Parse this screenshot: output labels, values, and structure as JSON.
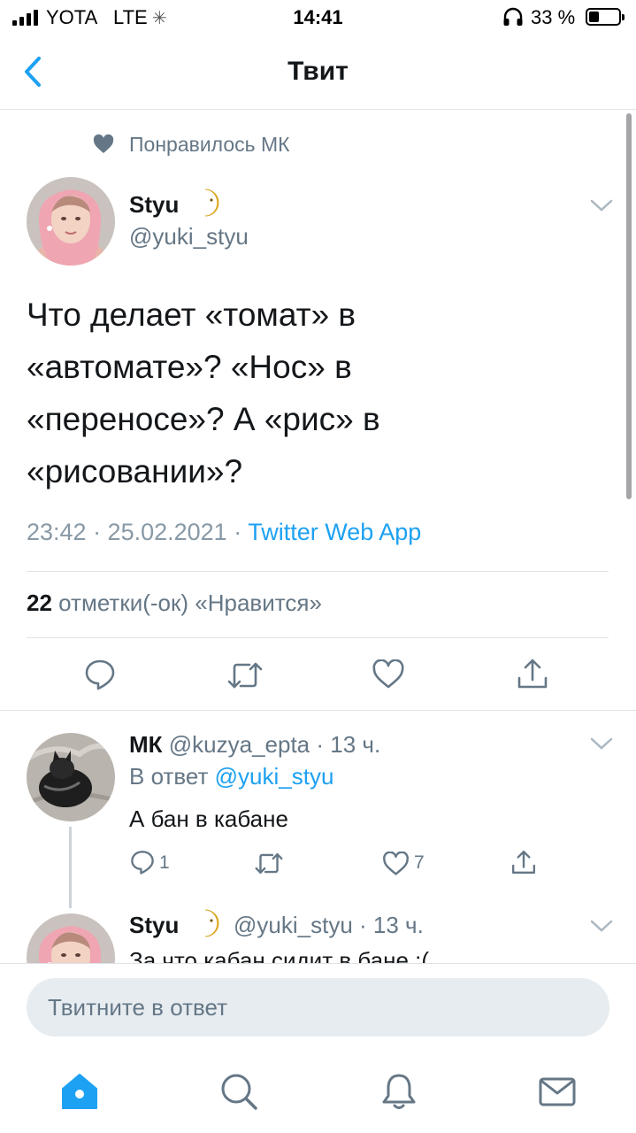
{
  "status_bar": {
    "carrier": "YOTA",
    "network": "LTE",
    "time": "14:41",
    "battery": "33 %"
  },
  "header": {
    "title": "Твит",
    "back_icon": "chevron-left-icon"
  },
  "social_context": {
    "icon": "heart-icon",
    "text": "Понравилось МК"
  },
  "tweet": {
    "author_name": "Styu",
    "author_emoji": "🌛",
    "author_handle": "@yuki_styu",
    "text": "Что делает «томат» в\n«автомате»? «Нос» в\n«переносе»? А  «рис» в\n«рисовании»?",
    "timestamp": "23:42 · 25.02.2021 · ",
    "source": "Twitter Web App",
    "likes_count": "22",
    "likes_label": " отметки(-ок) «Нравится»"
  },
  "replies": [
    {
      "name": "МК",
      "handle": "@kuzya_epta",
      "time": " · 13 ч.",
      "reply_to_label": "В ответ ",
      "reply_to_handle": "@yuki_styu",
      "text": "А бан в кабане",
      "reply_count": "1",
      "like_count": "7"
    },
    {
      "name": "Styu",
      "handle": "@yuki_styu",
      "time": " · 13 ч.",
      "text": "За что кабан сидит в бане :("
    }
  ],
  "compose": {
    "placeholder": "Твитните в ответ"
  },
  "colors": {
    "accent": "#1da1f2",
    "secondary_text": "#657786",
    "primary_text": "#14171a"
  }
}
